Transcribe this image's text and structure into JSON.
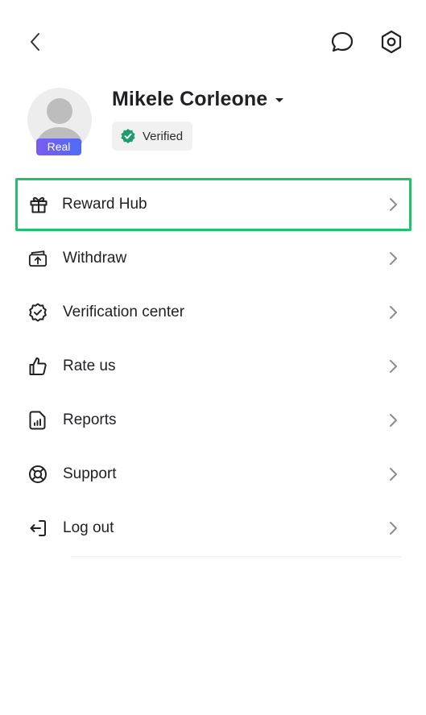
{
  "header": {
    "back_icon": "chevron-left-icon",
    "chat_icon": "chat-bubble-icon",
    "settings_icon": "settings-hexagon-icon"
  },
  "profile": {
    "name": "Mikele Corleone",
    "account_badge": "Real",
    "verified_label": "Verified",
    "accent_colors": {
      "badge_start": "#7a5cf0",
      "badge_end": "#4d6cf5",
      "verified_icon": "#1a9c6b",
      "highlight_border": "#22c26a"
    }
  },
  "menu": {
    "items": [
      {
        "label": "Reward Hub",
        "icon": "gift-icon",
        "highlighted": true
      },
      {
        "label": "Withdraw",
        "icon": "withdraw-icon"
      },
      {
        "label": "Verification center",
        "icon": "verification-badge-icon"
      },
      {
        "label": "Rate us",
        "icon": "thumbs-up-icon"
      },
      {
        "label": "Reports",
        "icon": "report-document-icon"
      },
      {
        "label": "Support",
        "icon": "lifebuoy-icon"
      },
      {
        "label": "Log out",
        "icon": "logout-icon"
      }
    ]
  }
}
